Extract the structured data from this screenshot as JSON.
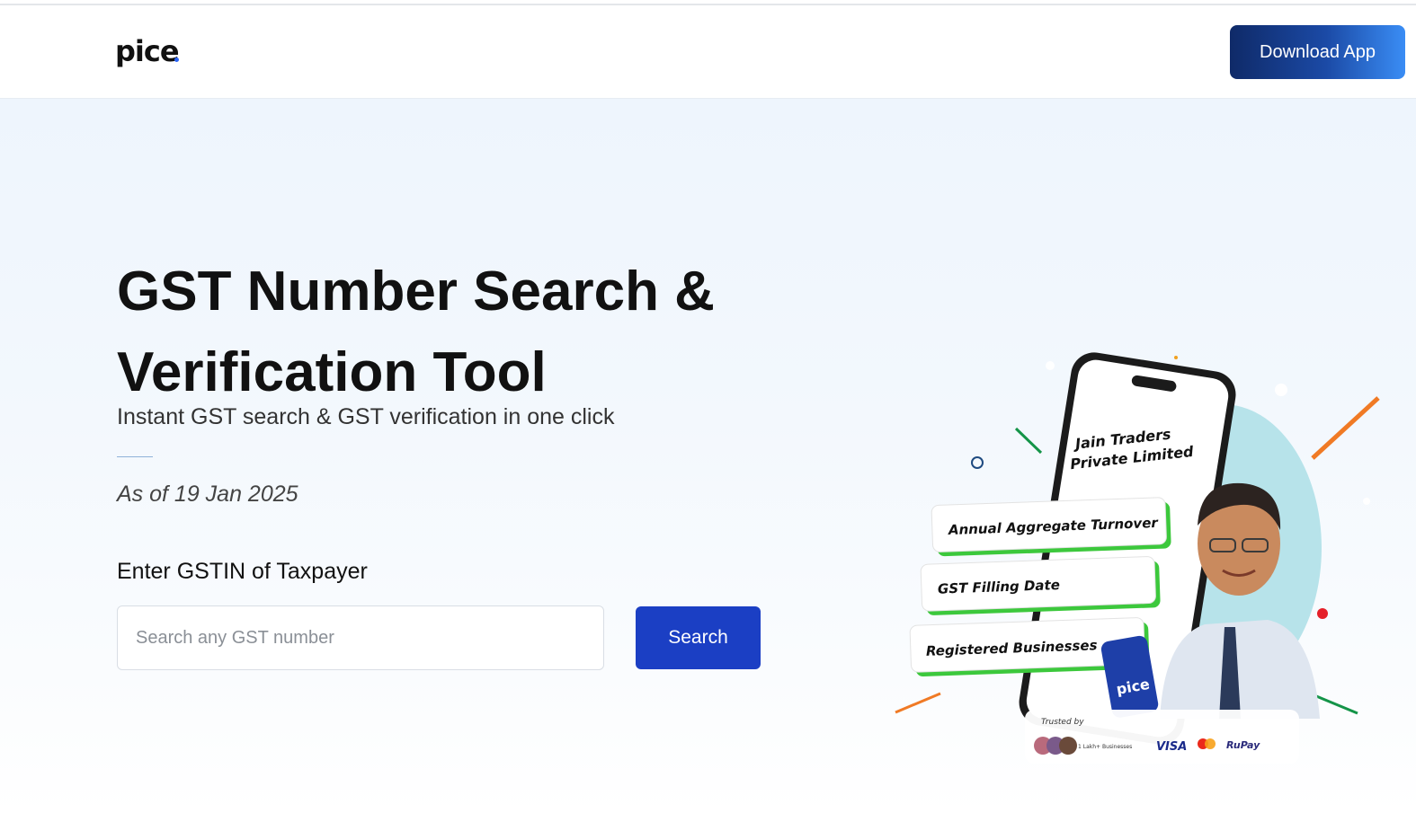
{
  "header": {
    "logo_text": "pice",
    "download_label": "Download App"
  },
  "hero": {
    "title_line1": "GST Number Search &",
    "title_line2": "Verification Tool",
    "subtitle": "Instant GST search & GST verification in one click",
    "as_of": "As of 19 Jan 2025",
    "gstin_label": "Enter GSTIN of Taxpayer",
    "search_placeholder": "Search any GST number",
    "search_value": "",
    "search_button": "Search"
  },
  "illustration": {
    "company_line1": "Jain Traders",
    "company_line2": "Private Limited",
    "card_turnover": "Annual Aggregate Turnover",
    "card_filing": "GST Filling Date",
    "card_registered": "Registered Businesses",
    "phone_logo": "pice",
    "trusted_by": "Trusted by",
    "businesses": "1 Lakh+ Businesses",
    "visa": "VISA",
    "rupay": "RuPay"
  },
  "colors": {
    "brand_blue": "#1b3fc4",
    "download_gradient_start": "#0f2a68",
    "download_gradient_end": "#3a8df5",
    "accent_orange": "#f07a25",
    "accent_green": "#149448",
    "card_border_green": "#3cc83c"
  }
}
